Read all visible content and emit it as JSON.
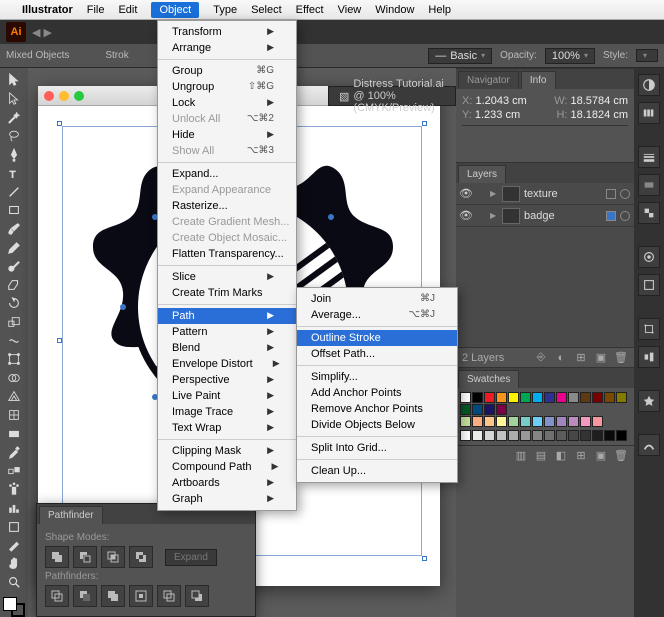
{
  "menubar": {
    "apple": "",
    "app": "Illustrator",
    "items": [
      "File",
      "Edit",
      "Object",
      "Type",
      "Select",
      "Effect",
      "View",
      "Window",
      "Help"
    ],
    "open_index": 2
  },
  "control_bar": {
    "selection_label": "Mixed Objects",
    "stroke_label": "Strok",
    "basic_label": "Basic",
    "opacity_label": "Opacity:",
    "opacity_value": "100%",
    "style_label": "Style:"
  },
  "document": {
    "tab_title": "Distress Tutorial.ai @ 100% (CMYK/Preview)"
  },
  "navigator": {
    "tab1": "Navigator",
    "tab2": "Info",
    "x_label": "X:",
    "x_value": "1.2043 cm",
    "y_label": "Y:",
    "y_value": "1.233 cm",
    "w_label": "W:",
    "w_value": "18.5784 cm",
    "h_label": "H:",
    "h_value": "18.1824 cm"
  },
  "layers": {
    "tab": "Layers",
    "items": [
      {
        "name": "texture",
        "selected": false
      },
      {
        "name": "badge",
        "selected": true
      }
    ],
    "footer": "2 Layers"
  },
  "swatches": {
    "tab": "Swatches",
    "colors_row1": [
      "#ffffff",
      "#000000",
      "#ed1c24",
      "#f7941d",
      "#fff200",
      "#00a651",
      "#00aeef",
      "#2e3192",
      "#ec008c",
      "#898989",
      "#603913",
      "#790000",
      "#7a4900",
      "#827b00",
      "#005826",
      "#004a80",
      "#1b1464",
      "#7b0046"
    ],
    "colors_row2": [
      "#c4df9b",
      "#f9ad81",
      "#fdc689",
      "#fff799",
      "#a3d39c",
      "#7accc8",
      "#6dcff6",
      "#8393ca",
      "#a186be",
      "#bd8cbf",
      "#f49ac1",
      "#f5989d"
    ],
    "grays": [
      "#ffffff",
      "#ebebeb",
      "#d7d7d7",
      "#c2c2c2",
      "#adadad",
      "#999999",
      "#858585",
      "#707070",
      "#5c5c5c",
      "#474747",
      "#333333",
      "#1f1f1f",
      "#0a0a0a",
      "#000000"
    ]
  },
  "object_menu": [
    {
      "label": "Transform",
      "sub": true
    },
    {
      "label": "Arrange",
      "sub": true
    },
    {
      "sep": true
    },
    {
      "label": "Group",
      "shortcut": "⌘G"
    },
    {
      "label": "Ungroup",
      "shortcut": "⇧⌘G"
    },
    {
      "label": "Lock",
      "sub": true
    },
    {
      "label": "Unlock All",
      "shortcut": "⌥⌘2",
      "disabled": true
    },
    {
      "label": "Hide",
      "sub": true
    },
    {
      "label": "Show All",
      "shortcut": "⌥⌘3",
      "disabled": true
    },
    {
      "sep": true
    },
    {
      "label": "Expand..."
    },
    {
      "label": "Expand Appearance",
      "disabled": true
    },
    {
      "label": "Rasterize..."
    },
    {
      "label": "Create Gradient Mesh...",
      "disabled": true
    },
    {
      "label": "Create Object Mosaic...",
      "disabled": true
    },
    {
      "label": "Flatten Transparency..."
    },
    {
      "sep": true
    },
    {
      "label": "Slice",
      "sub": true
    },
    {
      "label": "Create Trim Marks"
    },
    {
      "sep": true
    },
    {
      "label": "Path",
      "sub": true,
      "hl": true
    },
    {
      "label": "Pattern",
      "sub": true
    },
    {
      "label": "Blend",
      "sub": true
    },
    {
      "label": "Envelope Distort",
      "sub": true
    },
    {
      "label": "Perspective",
      "sub": true
    },
    {
      "label": "Live Paint",
      "sub": true
    },
    {
      "label": "Image Trace",
      "sub": true
    },
    {
      "label": "Text Wrap",
      "sub": true
    },
    {
      "sep": true
    },
    {
      "label": "Clipping Mask",
      "sub": true
    },
    {
      "label": "Compound Path",
      "sub": true
    },
    {
      "label": "Artboards",
      "sub": true
    },
    {
      "label": "Graph",
      "sub": true
    }
  ],
  "path_submenu": [
    {
      "label": "Join",
      "shortcut": "⌘J"
    },
    {
      "label": "Average...",
      "shortcut": "⌥⌘J"
    },
    {
      "sep": true
    },
    {
      "label": "Outline Stroke",
      "hl": true
    },
    {
      "label": "Offset Path..."
    },
    {
      "sep": true
    },
    {
      "label": "Simplify..."
    },
    {
      "label": "Add Anchor Points"
    },
    {
      "label": "Remove Anchor Points"
    },
    {
      "label": "Divide Objects Below"
    },
    {
      "sep": true
    },
    {
      "label": "Split Into Grid..."
    },
    {
      "sep": true
    },
    {
      "label": "Clean Up..."
    }
  ],
  "pathfinder": {
    "tab": "Pathfinder",
    "shape_modes": "Shape Modes:",
    "expand": "Expand",
    "pathfinders_label": "Pathfinders:"
  }
}
